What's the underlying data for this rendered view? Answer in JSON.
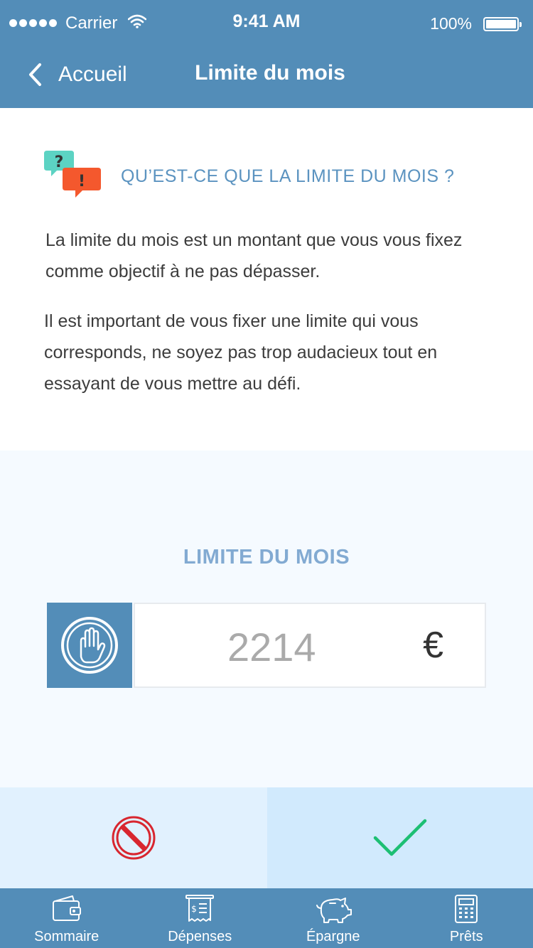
{
  "status_bar": {
    "carrier": "Carrier",
    "time": "9:41 AM",
    "battery": "100%"
  },
  "nav": {
    "back_label": "Accueil",
    "title": "Limite du mois"
  },
  "info": {
    "heading": "QU’EST-CE QUE LA LIMITE DU MOIS ?",
    "paragraph_1": "La limite du mois est un montant  que vous vous fixez comme objectif à ne pas dépasser.",
    "paragraph_2": "Il est important de vous fixer une limite qui vous corresponds, ne soyez pas trop audacieux tout en essayant de vous mettre au défi."
  },
  "limit": {
    "title": "LIMITE DU MOIS",
    "value": "2214",
    "currency": "€"
  },
  "actions": {
    "cancel_icon": "prohibited-icon",
    "confirm_icon": "checkmark-icon"
  },
  "tabs": [
    {
      "label": "Sommaire",
      "icon": "wallet-icon"
    },
    {
      "label": "Dépenses",
      "icon": "receipt-icon"
    },
    {
      "label": "Épargne",
      "icon": "piggy-bank-icon"
    },
    {
      "label": "Prêts",
      "icon": "calculator-icon"
    }
  ],
  "colors": {
    "primary": "#538db8",
    "heading_blue": "#5b93c0",
    "limit_title": "#82aad2",
    "cancel_red": "#d8262f",
    "confirm_green": "#1dbf73"
  }
}
